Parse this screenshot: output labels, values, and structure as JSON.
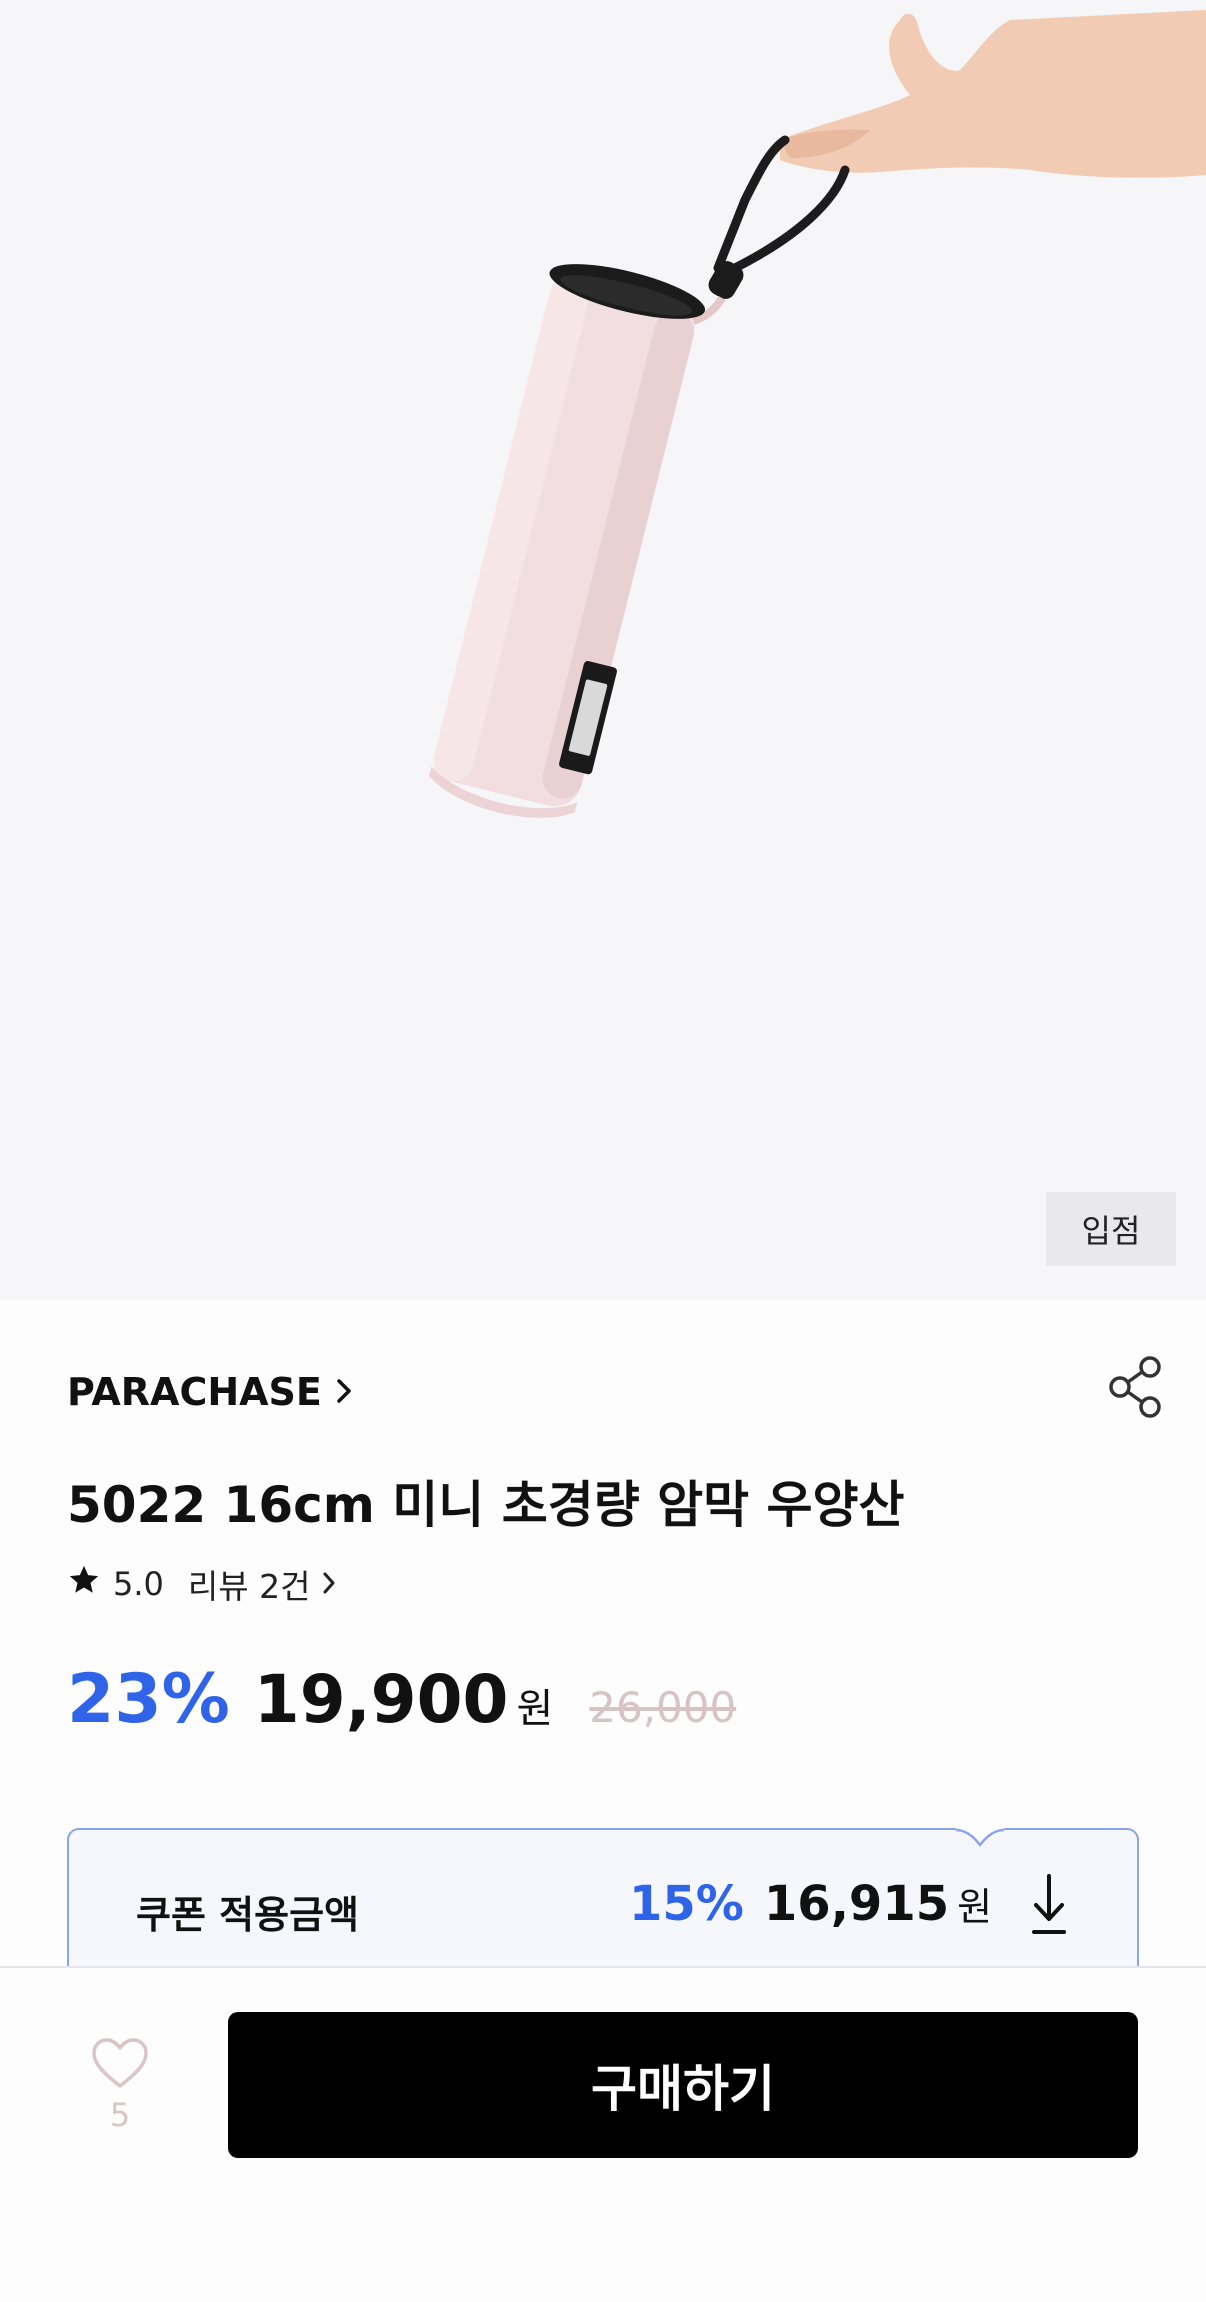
{
  "hero": {
    "image": "pink-mini-umbrella-held-by-hand",
    "store_badge": "입점"
  },
  "product": {
    "brand": "PARACHASE",
    "title": "5022 16cm 미니 초경량 암막 우양산",
    "rating": "5.0",
    "reviews_label": "리뷰 2건",
    "discount": "23%",
    "price": "19,900",
    "currency": "원",
    "original_price": "26,000"
  },
  "coupon": {
    "label": "쿠폰 적용금액",
    "discount": "15%",
    "price": "16,915",
    "currency": "원"
  },
  "bottom_bar": {
    "like_count": "5",
    "buy_label": "구매하기"
  },
  "colors": {
    "accent_blue": "#2f63e8",
    "like_pink": "#d9c4c7",
    "coupon_border": "#8aa5ee"
  },
  "icons": [
    "share-icon",
    "chevron-right-icon",
    "star-icon",
    "download-icon",
    "heart-icon"
  ]
}
